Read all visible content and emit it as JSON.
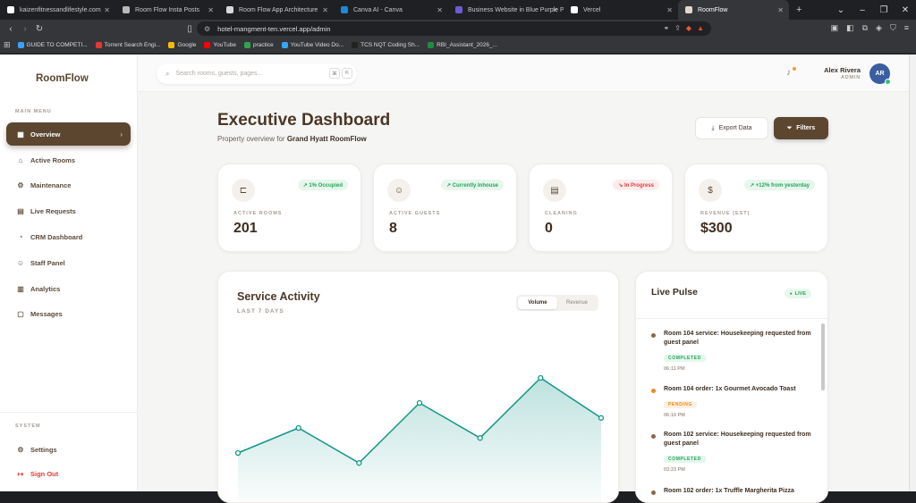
{
  "browser": {
    "tabs": [
      {
        "label": "kaizenfitnessandlifestyle.com",
        "color": "#ffffff",
        "active": false
      },
      {
        "label": "Room Flow Insta Posts",
        "color": "#b9b9b9",
        "active": false
      },
      {
        "label": "Room Flow App Architecture",
        "color": "#d9d9d9",
        "active": false
      },
      {
        "label": "Canva AI - Canva",
        "color": "#1c8ad6",
        "active": false
      },
      {
        "label": "Business Website in Blue Purple Prof",
        "color": "#6b5bd6",
        "active": false
      },
      {
        "label": "Vercel",
        "color": "#ffffff",
        "active": false
      },
      {
        "label": "RoomFlow",
        "color": "#e0d8cc",
        "active": true
      }
    ],
    "url": "hotel-mangment-ten.vercel.app/admin",
    "bookmarks": [
      {
        "label": "GUIDE TO COMPETI...",
        "color": "#3aa1ff"
      },
      {
        "label": "Torrent Search Engi...",
        "color": "#e53935"
      },
      {
        "label": "Google",
        "color": "#fbbc05"
      },
      {
        "label": "YouTube",
        "color": "#ff0000"
      },
      {
        "label": "practice",
        "color": "#2ea44f"
      },
      {
        "label": "YouTube Video Do...",
        "color": "#34a6f5"
      },
      {
        "label": "TCS NQT Coding Sh...",
        "color": "#222222"
      },
      {
        "label": "RBI_Assistant_2026_...",
        "color": "#1e8e3e"
      }
    ]
  },
  "sidebar": {
    "logo": "RoomFlow",
    "main_caption": "MAIN MENU",
    "items": [
      {
        "label": "Overview",
        "icon": "grid-icon",
        "glyph": "▦"
      },
      {
        "label": "Active Rooms",
        "icon": "bed-icon",
        "glyph": "⌂"
      },
      {
        "label": "Maintenance",
        "icon": "gear-icon",
        "glyph": "⚙"
      },
      {
        "label": "Live Requests",
        "icon": "clipboard-icon",
        "glyph": "▤"
      },
      {
        "label": "CRM Dashboard",
        "icon": "chart-icon",
        "glyph": "◔"
      },
      {
        "label": "Staff Panel",
        "icon": "users-icon",
        "glyph": "☺"
      },
      {
        "label": "Analytics",
        "icon": "bar-chart-icon",
        "glyph": "▥"
      },
      {
        "label": "Messages",
        "icon": "message-icon",
        "glyph": "▢"
      }
    ],
    "system_caption": "SYSTEM",
    "settings": "Settings",
    "signout": "Sign Out"
  },
  "topbar": {
    "search_placeholder": "Search rooms, guests, pages...",
    "kbd1": "⌘",
    "kbd2": "K",
    "user_name": "Alex Rivera",
    "user_role": "ADMIN",
    "avatar_initials": "AR"
  },
  "header": {
    "title": "Executive Dashboard",
    "subtitle_prefix": "Property overview for",
    "property": "Grand Hyatt RoomFlow",
    "export_label": "Export Data",
    "filters_label": "Filters"
  },
  "stats": [
    {
      "label": "ACTIVE ROOMS",
      "value": "201",
      "badge": "↗ 1% Occupied",
      "tone": "green",
      "icon": "bed-icon",
      "glyph": "⊏"
    },
    {
      "label": "ACTIVE GUESTS",
      "value": "8",
      "badge": "↗ Currently Inhouse",
      "tone": "green",
      "icon": "users-icon",
      "glyph": "☺"
    },
    {
      "label": "CLEANING",
      "value": "0",
      "badge": "↘ In Progress",
      "tone": "red",
      "icon": "clipboard-icon",
      "glyph": "▤"
    },
    {
      "label": "REVENUE (EST)",
      "value": "$300",
      "badge": "↗ +12% from yesterday",
      "tone": "green",
      "icon": "dollar-icon",
      "glyph": "$"
    }
  ],
  "service": {
    "title": "Service Activity",
    "subtitle": "LAST 7 DAYS",
    "toggle_volume": "Volume",
    "toggle_revenue": "Revenue"
  },
  "chart_data": {
    "type": "area",
    "x": [
      1,
      2,
      3,
      4,
      5,
      6,
      7
    ],
    "values": [
      2.0,
      3.0,
      1.6,
      4.0,
      2.6,
      5.0,
      3.4
    ],
    "ylim": [
      0,
      6
    ],
    "color": "#14968a",
    "grid": false
  },
  "pulse": {
    "title": "Live Pulse",
    "live_badge": "LIVE",
    "items": [
      {
        "text": "Room 104 service: Housekeeping requested from guest panel",
        "status": "COMPLETED",
        "time": "06:11 PM",
        "dot": "#8a6a45"
      },
      {
        "text": "Room 104 order: 1x Gourmet Avocado Toast",
        "status": "PENDING",
        "time": "06:10 PM",
        "dot": "#f08a1c"
      },
      {
        "text": "Room 102 service: Housekeeping requested from guest panel",
        "status": "COMPLETED",
        "time": "03:23 PM",
        "dot": "#8a6a45"
      },
      {
        "text": "Room 102 order: 1x Truffle Margherita Pizza",
        "status": "",
        "time": "",
        "dot": "#8a6a45"
      }
    ]
  }
}
